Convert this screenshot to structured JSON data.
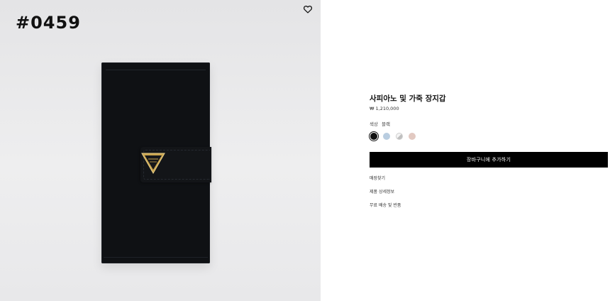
{
  "overlay": {
    "id_label": "#0459"
  },
  "product": {
    "name": "사피아노 및 가죽 장지갑",
    "price": "₩ 1,210,000",
    "color_label": "색상",
    "color_value": "블랙",
    "swatches": [
      {
        "name": "black",
        "color": "#101010",
        "selected": true
      },
      {
        "name": "light-blue",
        "color": "#b9cde0",
        "selected": false
      },
      {
        "name": "white-grey",
        "color": "#f4f4f4",
        "selected": false
      },
      {
        "name": "pink",
        "color": "#e2c9c1",
        "selected": false
      }
    ]
  },
  "actions": {
    "add_to_cart": "장바구니에 추가하기",
    "store_finder": "매장찾기",
    "product_details": "제품 상세정보",
    "shipping_returns": "무료 배송 및 반품"
  },
  "icons": {
    "wishlist": "heart-icon"
  }
}
